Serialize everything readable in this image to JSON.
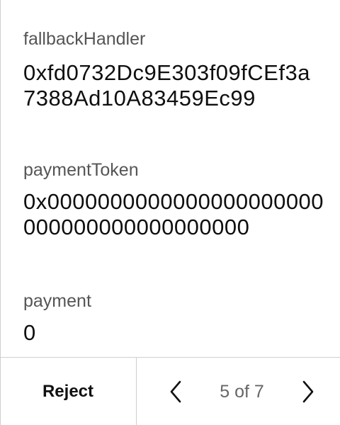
{
  "fields": [
    {
      "label": "fallbackHandler",
      "value": "0xfd0732Dc9E303f09fCEf3a7388Ad10A83459Ec99"
    },
    {
      "label": "paymentToken",
      "value": "0x0000000000000000000000000000000000000000"
    },
    {
      "label": "payment",
      "value": "0"
    }
  ],
  "footer": {
    "reject_label": "Reject",
    "pagination": "5 of 7",
    "prev_icon": "chevron-left-icon",
    "next_icon": "chevron-right-icon"
  }
}
